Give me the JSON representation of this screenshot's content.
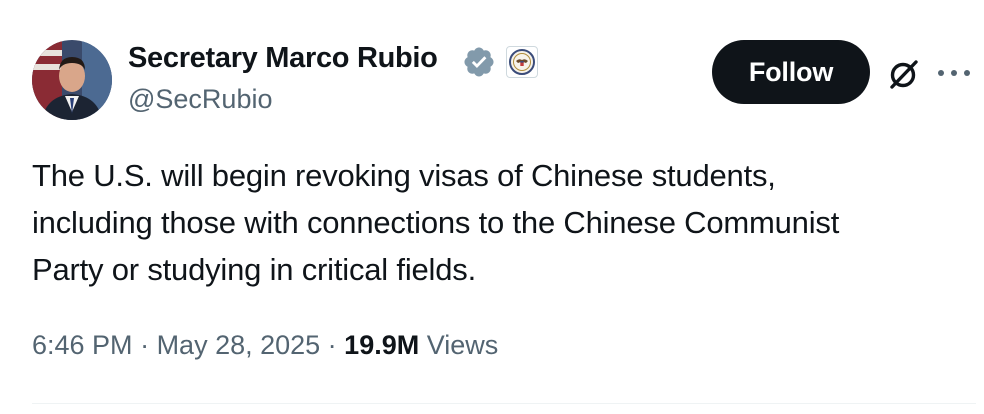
{
  "author": {
    "display_name": "Secretary Marco Rubio",
    "handle": "@SecRubio",
    "verified_badge_color": "#829aab",
    "avatar_icon": "avatar-photo",
    "affiliation_icon": "state-department-seal-icon"
  },
  "actions": {
    "follow_label": "Follow",
    "grok_icon": "grok-icon",
    "more_icon": "more-options-icon"
  },
  "tweet": {
    "text": "The U.S. will begin revoking visas of Chinese students,\nincluding those with connections to the Chinese Communist\nParty or studying in critical fields."
  },
  "meta": {
    "time": "6:46 PM",
    "separator1": " · ",
    "date": "May 28, 2025",
    "separator2": " · ",
    "views_count": "19.9M",
    "views_label": " Views"
  },
  "colors": {
    "text_primary": "#0f1419",
    "text_secondary": "#536471",
    "follow_bg": "#0f1419",
    "divider": "#eff3f4"
  }
}
